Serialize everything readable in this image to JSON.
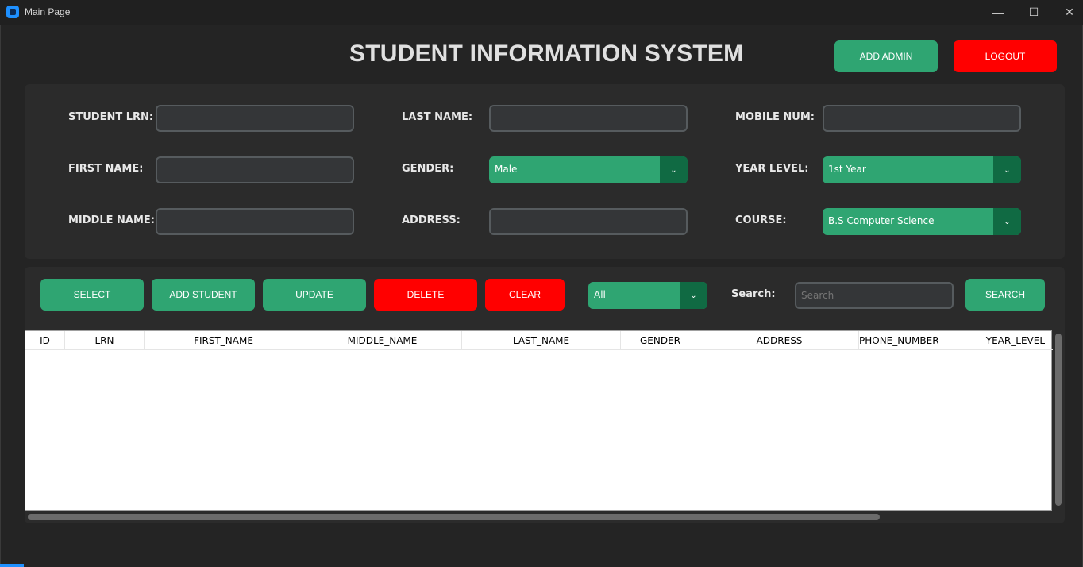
{
  "window": {
    "title": "Main Page",
    "minimize_icon": "minimize-icon",
    "maximize_icon": "maximize-icon",
    "close_icon": "close-icon"
  },
  "header": {
    "title": "STUDENT INFORMATION SYSTEM",
    "add_admin_label": "ADD ADMIN",
    "logout_label": "LOGOUT"
  },
  "form": {
    "student_lrn": {
      "label": "STUDENT LRN:",
      "value": ""
    },
    "first_name": {
      "label": "FIRST NAME:",
      "value": ""
    },
    "middle_name": {
      "label": "MIDDLE NAME:",
      "value": ""
    },
    "last_name": {
      "label": "LAST NAME:",
      "value": ""
    },
    "gender": {
      "label": "GENDER:",
      "value": "Male"
    },
    "address": {
      "label": "ADDRESS:",
      "value": ""
    },
    "mobile_num": {
      "label": "MOBILE NUM:",
      "value": ""
    },
    "year_level": {
      "label": "YEAR LEVEL:",
      "value": "1st Year"
    },
    "course": {
      "label": "COURSE:",
      "value": "B.S Computer Science"
    }
  },
  "actions": {
    "select_label": "SELECT",
    "add_student_label": "ADD STUDENT",
    "update_label": "UPDATE",
    "delete_label": "DELETE",
    "clear_label": "CLEAR",
    "filter_value": "All",
    "search_label": "Search:",
    "search_placeholder": "Search",
    "search_button_label": "SEARCH"
  },
  "table": {
    "columns": [
      "ID",
      "LRN",
      "FIRST_NAME",
      "MIDDLE_NAME",
      "LAST_NAME",
      "GENDER",
      "ADDRESS",
      "PHONE_NUMBER",
      "YEAR_LEVEL"
    ],
    "rows": []
  },
  "colors": {
    "accent_green": "#2fa572",
    "dark_green": "#106a43",
    "danger_red": "#ff0000",
    "background": "#242424",
    "panel": "#2b2b2b"
  }
}
